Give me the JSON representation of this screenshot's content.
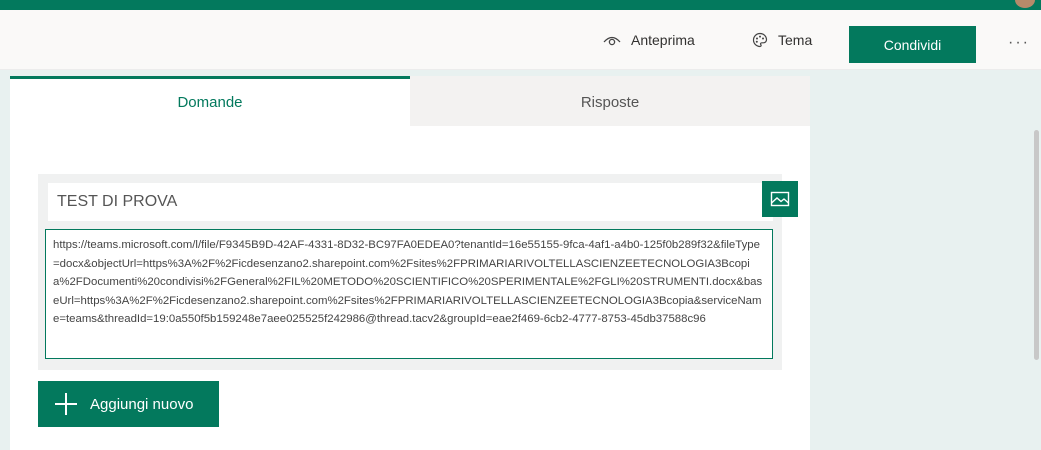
{
  "colors": {
    "accent": "#03795d",
    "toolbar_bg": "#faf9f8",
    "page_bg": "#e8f1f0"
  },
  "toolbar": {
    "preview_label": "Anteprima",
    "preview_icon": "eye-icon",
    "theme_label": "Tema",
    "theme_icon": "palette-icon",
    "share_label": "Condividi",
    "more_label": "···"
  },
  "tabs": [
    {
      "label": "Domande",
      "active": true
    },
    {
      "label": "Risposte",
      "active": false
    }
  ],
  "form": {
    "title": "TEST DI PROVA",
    "image_icon": "image-icon",
    "description": "https://teams.microsoft.com/l/file/F9345B9D-42AF-4331-8D32-BC97FA0EDEA0?tenantId=16e55155-9fca-4af1-a4b0-125f0b289f32&fileType=docx&objectUrl=https%3A%2F%2Ficdesenzano2.sharepoint.com%2Fsites%2FPRIMARIARIVOLTELLASCIENZEETECNOLOGIA3Bcopia%2FDocumenti%20condivisi%2FGeneral%2FIL%20METODO%20SCIENTIFICO%20SPERIMENTALE%2FGLI%20STRUMENTI.docx&baseUrl=https%3A%2F%2Ficdesenzano2.sharepoint.com%2Fsites%2FPRIMARIARIVOLTELLASCIENZEETECNOLOGIA3Bcopia&serviceName=teams&threadId=19:0a550f5b159248e7aee025525f242986@thread.tacv2&groupId=eae2f469-6cb2-4777-8753-45db37588c96"
  },
  "add_button": {
    "label": "Aggiungi nuovo",
    "icon": "plus-icon"
  }
}
